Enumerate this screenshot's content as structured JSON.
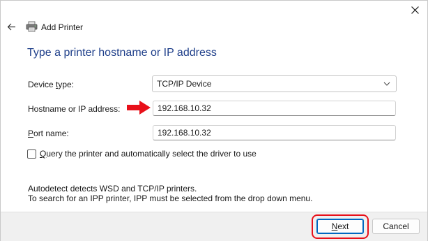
{
  "window": {
    "title": "Add Printer",
    "close_icon": "close-icon",
    "back_icon": "back-arrow-icon",
    "printer_icon": "printer-icon"
  },
  "page": {
    "heading": "Type a printer hostname or IP address"
  },
  "form": {
    "device_type": {
      "label_pre": "Device ",
      "label_ul": "t",
      "label_post": "ype:",
      "value": "TCP/IP Device"
    },
    "hostname": {
      "label": "Hostname or IP address:",
      "value": "192.168.10.32"
    },
    "port_name": {
      "label_ul": "P",
      "label_post": "ort name:",
      "value": "192.168.10.32"
    },
    "query_checkbox": {
      "label_ul": "Q",
      "label_post": "uery the printer and automatically select the driver to use",
      "checked": false
    }
  },
  "info": {
    "line1": "Autodetect detects WSD and TCP/IP printers.",
    "line2": "To search for an IPP printer, IPP must be selected from the drop down menu."
  },
  "footer": {
    "next_ul": "N",
    "next_post": "ext",
    "cancel_label": "Cancel"
  },
  "annotations": {
    "arrow_color": "#e8101a",
    "highlight_color": "#e8101a"
  }
}
